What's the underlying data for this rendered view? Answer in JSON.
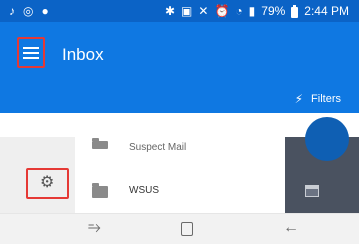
{
  "status_bar": {
    "left_icons": [
      "music-icon",
      "app-icon",
      "message-icon"
    ],
    "right_text": "79%",
    "time": "2:44 PM"
  },
  "app_bar": {
    "title": "Inbox",
    "filters_label": "Filters",
    "filters_icon": "bolt-icon",
    "menu_icon": "hamburger-menu-icon"
  },
  "folders": [
    {
      "name": "Suspect Mail"
    },
    {
      "name": "WSUS"
    }
  ],
  "colors": {
    "primary": "#0f78e2",
    "status_bar": "#0b63c6",
    "highlight": "#e53935"
  }
}
